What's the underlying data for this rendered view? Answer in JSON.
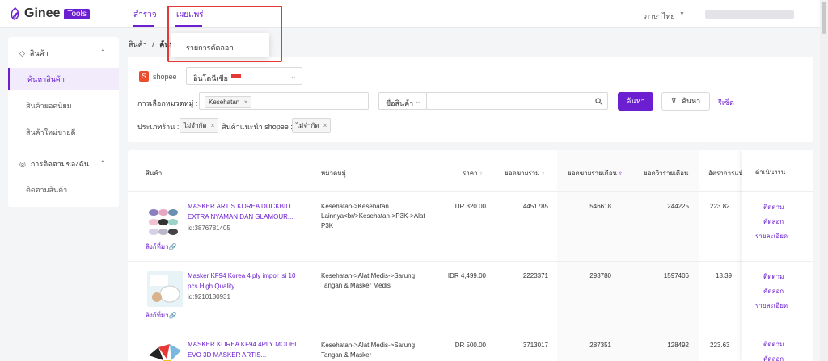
{
  "header": {
    "logo_name": "Ginee",
    "logo_badge": "Tools",
    "tabs": [
      "สำรวจ",
      "เผยแพร่"
    ],
    "language": "ภาษาไทย"
  },
  "dropdown": {
    "item": "รายการคัดลอก"
  },
  "sidebar": {
    "group1": "สินค้า",
    "items": [
      "ค้นหาสินค้า",
      "สินค้ายอดนิยม",
      "สินค้าใหม่ขายดี"
    ],
    "group2": "การติดตามของฉัน",
    "items2": [
      "ติดตามสินค้า"
    ]
  },
  "breadcrumb": {
    "root": "สินค้า",
    "sep": "/",
    "current": "ค้นหาสินค้า"
  },
  "filters": {
    "platform": "shopee",
    "country": "อินโดนีเซีย",
    "category_label": "การเลือกหมวดหมู่ :",
    "category_tag": "Kesehatan",
    "search_field": "ชื่อสินค้า",
    "search_btn": "ค้นหา",
    "filter_btn": "ค้นหา",
    "reset": "รีเซ็ต",
    "shop_type_label": "ประเภทร้าน :",
    "shop_type_tag": "ไม่จำกัด",
    "recommend_label": "สินค้าแนะนำ shopee :",
    "recommend_tag": "ไม่จำกัด"
  },
  "table": {
    "columns": [
      "สินค้า",
      "หมวดหมู่",
      "ราคา",
      "ยอดขายรวม",
      "ยอดขายรายเดือน",
      "ยอดวิวรายเดือน",
      "อัตราการแปล",
      "ดำเนินงาน"
    ],
    "link_label": "ลิงก์ที่มา",
    "actions": [
      "ติดตาม",
      "คัดลอก",
      "รายละเอียด"
    ],
    "rows": [
      {
        "title": "MASKER ARTIS KOREA DUCKBILL EXTRA NYAMAN DAN GLAMOUR...",
        "id": "id:3876781405",
        "category": "Kesehatan->Kesehatan Lainnya<br/>Kesehatan->P3K->Alat P3K",
        "price": "IDR 320.00",
        "total": "4451785",
        "monthly": "546618",
        "views": "244225",
        "conv": "223.82"
      },
      {
        "title": "Masker KF94 Korea 4 ply impor isi 10 pcs High Quality",
        "id": "id:9210130931",
        "category": "Kesehatan->Alat Medis->Sarung Tangan & Masker Medis",
        "price": "IDR 4,499.00",
        "total": "2223371",
        "monthly": "293780",
        "views": "1597406",
        "conv": "18.39"
      },
      {
        "title": "MASKER KOREA KF94 4PLY MODEL EVO 3D MASKER ARTIS...",
        "id": "",
        "category": "Kesehatan->Alat Medis->Sarung Tangan & Masker",
        "price": "IDR 500.00",
        "total": "3713017",
        "monthly": "287351",
        "views": "128492",
        "conv": "223.63"
      }
    ]
  },
  "colors": {
    "accent": "#6c1ed1",
    "shopee": "#ee4d2d",
    "highlight": "#e53935"
  }
}
